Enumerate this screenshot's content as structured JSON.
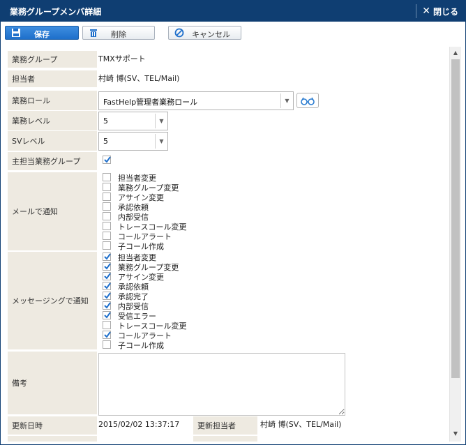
{
  "window": {
    "title": "業務グループメンバ詳細",
    "close_label": "閉じる"
  },
  "toolbar": {
    "save_label": "保存",
    "delete_label": "削除",
    "cancel_label": "キャンセル"
  },
  "form": {
    "business_group": {
      "label": "業務グループ",
      "value": "TMXサポート"
    },
    "person_in_charge": {
      "label": "担当者",
      "value": "村崎 博(SV、TEL/Mail)"
    },
    "business_role": {
      "label": "業務ロール",
      "value": "FastHelp管理者業務ロール"
    },
    "business_level": {
      "label": "業務レベル",
      "value": "5"
    },
    "sv_level": {
      "label": "SVレベル",
      "value": "5"
    },
    "main_group": {
      "label": "主担当業務グループ",
      "checked": true
    },
    "mail_notify": {
      "label": "メールで通知",
      "items": [
        {
          "label": "担当者変更",
          "checked": false
        },
        {
          "label": "業務グループ変更",
          "checked": false
        },
        {
          "label": "アサイン変更",
          "checked": false
        },
        {
          "label": "承認依頼",
          "checked": false
        },
        {
          "label": "内部受信",
          "checked": false
        },
        {
          "label": "トレースコール変更",
          "checked": false
        },
        {
          "label": "コールアラート",
          "checked": false
        },
        {
          "label": "子コール作成",
          "checked": false
        }
      ]
    },
    "message_notify": {
      "label": "メッセージングで通知",
      "items": [
        {
          "label": "担当者変更",
          "checked": true
        },
        {
          "label": "業務グループ変更",
          "checked": true
        },
        {
          "label": "アサイン変更",
          "checked": true
        },
        {
          "label": "承認依頼",
          "checked": true
        },
        {
          "label": "承認完了",
          "checked": true
        },
        {
          "label": "内部受信",
          "checked": true
        },
        {
          "label": "受信エラー",
          "checked": true
        },
        {
          "label": "トレースコール変更",
          "checked": false
        },
        {
          "label": "コールアラート",
          "checked": true
        },
        {
          "label": "子コール作成",
          "checked": false
        }
      ]
    },
    "remarks": {
      "label": "備考",
      "value": ""
    },
    "updated_at": {
      "label": "更新日時",
      "value": "2015/02/02 13:37:17"
    },
    "updated_by": {
      "label": "更新担当者",
      "value": "村崎 博(SV、TEL/Mail)"
    }
  },
  "colors": {
    "titlebar": "#0f3e72",
    "label_bg": "#eeeae1",
    "accent": "#1e6fcb"
  }
}
